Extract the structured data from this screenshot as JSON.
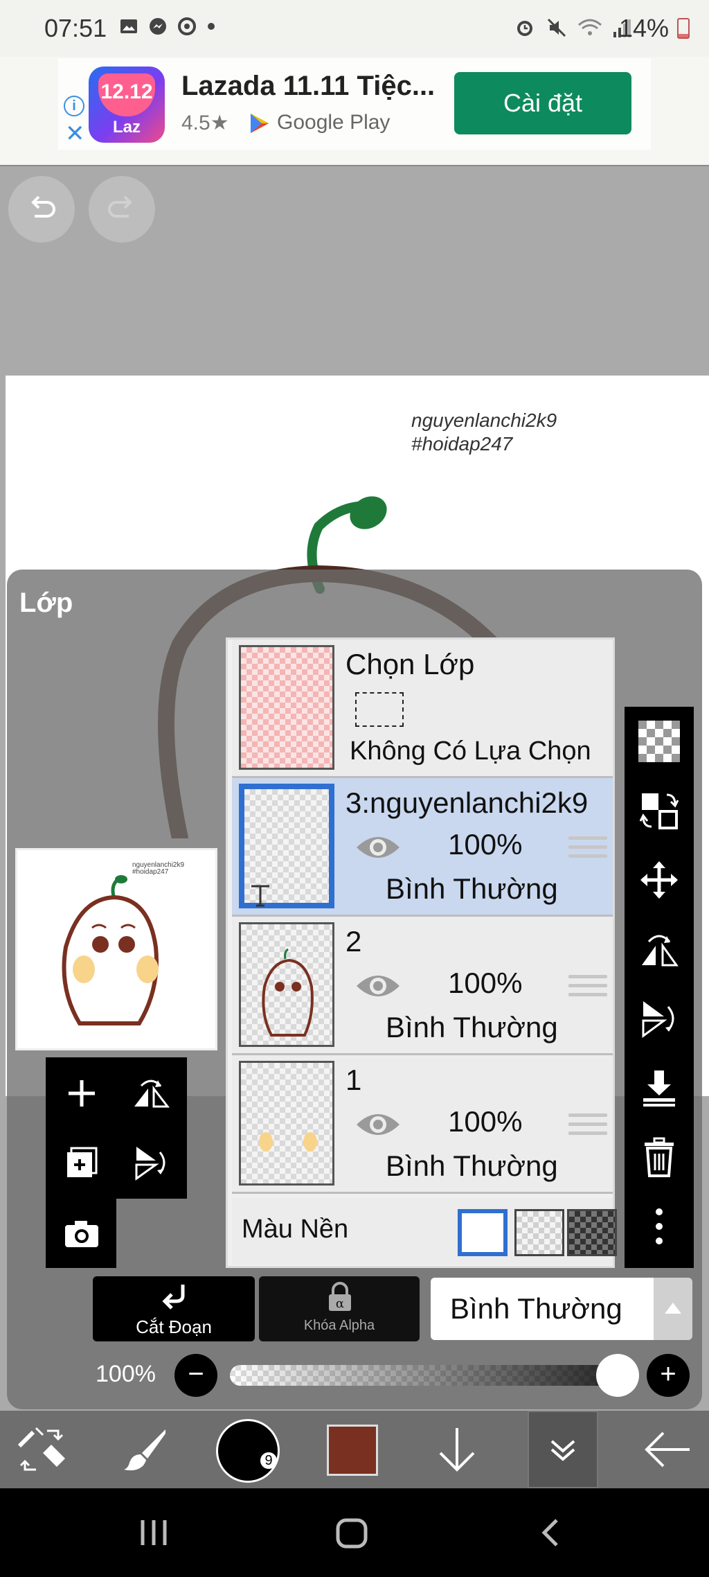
{
  "status_bar": {
    "time": "07:51",
    "battery": "14%"
  },
  "ad": {
    "logo_top": "12.12",
    "logo_bottom": "Laz",
    "title": "Lazada 11.11 Tiệc...",
    "rating": "4.5★",
    "store": "Google Play",
    "install_button": "Cài đặt"
  },
  "canvas": {
    "watermark_line1": "nguyenlanchi2k9",
    "watermark_line2": "#hoidap247"
  },
  "layers_panel": {
    "title": "Lớp",
    "selection_layer": {
      "name": "Chọn Lớp",
      "status": "Không Có Lựa Chọn"
    },
    "layers": [
      {
        "name": "3:nguyenlanchi2k9",
        "opacity": "100%",
        "blend": "Bình Thường",
        "selected": true
      },
      {
        "name": "2",
        "opacity": "100%",
        "blend": "Bình Thường",
        "selected": false
      },
      {
        "name": "1",
        "opacity": "100%",
        "blend": "Bình Thường",
        "selected": false
      }
    ],
    "background_label": "Màu Nền"
  },
  "controls": {
    "cut_label": "Cắt Đoạn",
    "alpha_label": "Khóa Alpha",
    "blend_mode": "Bình Thường",
    "opacity_label": "100%",
    "opacity_value": 1.0
  },
  "toolbar": {
    "brush_size": "9",
    "color": "#7a3020"
  }
}
